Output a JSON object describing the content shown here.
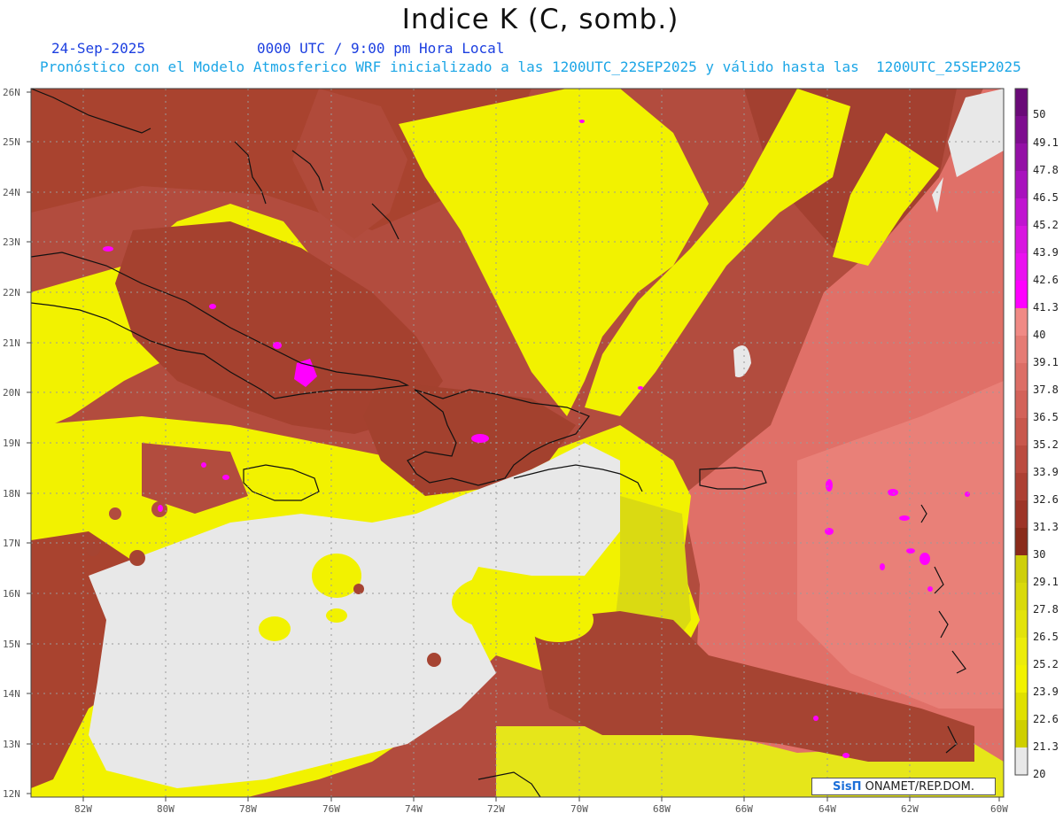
{
  "header": {
    "title": "Indice K (C, somb.)",
    "date": "24-Sep-2025",
    "time": "0000 UTC / 9:00 pm Hora Local",
    "forecast_line": "Pronóstico con el Modelo Atmosferico WRF inicializado a las 1200UTC_22SEP2025 y válido hasta las  1200UTC_25SEP2025"
  },
  "map": {
    "lat_labels": [
      "26N",
      "25N",
      "24N",
      "23N",
      "22N",
      "21N",
      "20N",
      "19N",
      "18N",
      "17N",
      "16N",
      "15N",
      "14N",
      "13N",
      "12N"
    ],
    "lon_labels": [
      "82W",
      "80W",
      "78W",
      "76W",
      "74W",
      "72W",
      "70W",
      "68W",
      "66W",
      "64W",
      "62W",
      "60W"
    ],
    "colors": {
      "below_20": "#e8e8e8",
      "band_20_30": "#f2f200",
      "band_30_40_low": "#9a3a22",
      "band_30_40_mid": "#c85a4e",
      "band_30_40_high": "#e57b74",
      "band_40_plus": "#ff00ff"
    }
  },
  "colorbar": {
    "labels": [
      "50",
      "49.1",
      "47.8",
      "46.5",
      "45.2",
      "43.9",
      "42.6",
      "41.3",
      "40",
      "39.1",
      "37.8",
      "36.5",
      "35.2",
      "33.9",
      "32.6",
      "31.3",
      "30",
      "29.1",
      "27.8",
      "26.5",
      "25.2",
      "23.9",
      "22.6",
      "21.3",
      "20"
    ],
    "colors": [
      "#6a0a78",
      "#7e0d8f",
      "#9410a6",
      "#a812bd",
      "#c014d0",
      "#d815e0",
      "#ea10f0",
      "#ff00ff",
      "#f08a85",
      "#e57b74",
      "#dc6e66",
      "#d36259",
      "#c8574c",
      "#bb4b3f",
      "#ad4033",
      "#9d3427",
      "#8a2b1a",
      "#cfcf0a",
      "#d9d90a",
      "#e3e30a",
      "#ecec0a",
      "#f2f200",
      "#e0e000",
      "#cfcf00",
      "#e8e8e8"
    ]
  },
  "credit": {
    "logo": "SisΠ",
    "text": " ONAMET/REP.DOM."
  }
}
